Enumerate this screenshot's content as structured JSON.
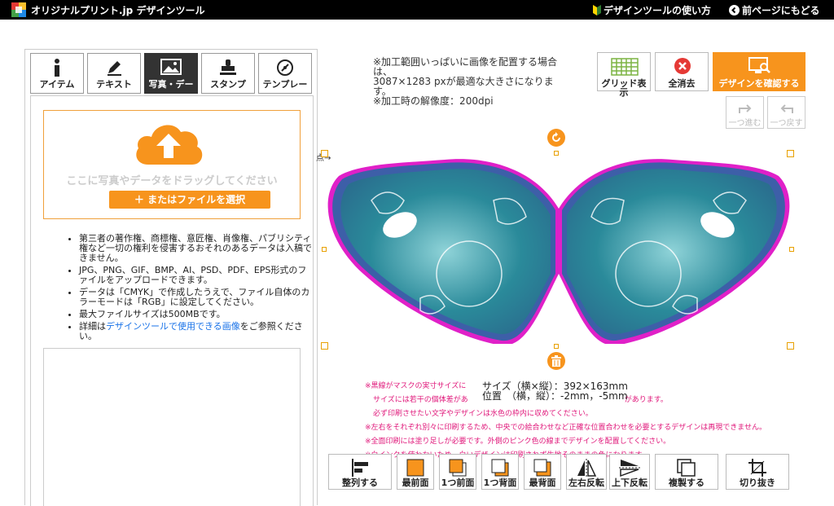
{
  "topbar": {
    "brand": "オリジナルプリント.jp デザインツール",
    "help_link": "デザインツールの使い方",
    "back_link": "前ページにもどる"
  },
  "tabs": [
    {
      "label": "アイテム",
      "icon": "info-icon"
    },
    {
      "label": "テキスト",
      "icon": "pen-icon"
    },
    {
      "label": "写真・デー",
      "icon": "image-icon",
      "active": true
    },
    {
      "label": "スタンプ",
      "icon": "stamp-icon"
    },
    {
      "label": "テンプレー",
      "icon": "template-icon"
    }
  ],
  "upload": {
    "drop_text": "ここに写真やデータをドラッグしてください",
    "file_button": "＋ またはファイルを選択"
  },
  "notes": {
    "n1": "第三者の著作権、商標権、意匠権、肖像権、パブリシティ権など一切の権利を侵害するおそれのあるデータは入稿できません。",
    "n2": "JPG、PNG、GIF、BMP、AI、PSD、PDF、EPS形式のファイルをアップロードできます。",
    "n3": "データは「CMYK」で作成したうえで、ファイル自体のカラーモードは「RGB」に設定してください。",
    "n4": "最大ファイルサイズは500MBです。",
    "n5_pre": "詳細は",
    "n5_link": "デザインツールで使用できる画像",
    "n5_post": "をご参照ください。"
  },
  "hint": {
    "line1": "※加工範囲いっぱいに画像を配置する場合は、",
    "line2": "3087×1283 pxが最適な大きさになります。",
    "line3": "※加工時の解像度：200dpi"
  },
  "toolbar": {
    "grid_label": "グリッド表示",
    "clear_label": "全消去",
    "confirm_label": "デザインを確認する",
    "redo_label": "一つ進む",
    "undo_label": "一つ戻す"
  },
  "canvas": {
    "arrow_mark": "点→"
  },
  "size_info": {
    "size": "サイズ（横×縦）：392×163mm",
    "position": "位置　（横，縦）：-2mm，-5mm"
  },
  "warnings": {
    "w1": "※黒線がマスクの実寸サイズに",
    "w2": "サイズには若干の個体差があ",
    "w2b": "があります。",
    "w3": "必ず印刷させたい文字やデザインは水色の枠内に収めてください。",
    "w4": "※左右をそれぞれ別々に印刷するため、中央での絵合わせなど正確な位置合わせを必要とするデザインは再現できません。",
    "w5": "※全面印刷には塗り足しが必要です。外側のピンク色の線までデザインを配置してください。",
    "w6": "※白インクを使わないため、白いデザインは印刷されず生地そのままの色になります。"
  },
  "bottom_buttons": [
    {
      "label": "整列する"
    },
    {
      "label": "最前面"
    },
    {
      "label": "1つ前面"
    },
    {
      "label": "1つ背面"
    },
    {
      "label": "最背面"
    },
    {
      "label": "左右反転"
    },
    {
      "label": "上下反転"
    },
    {
      "label": "複製する"
    },
    {
      "label": "切り抜き"
    }
  ],
  "colors": {
    "accent": "#f7941d",
    "mask_teal": "#2a8a9a",
    "mask_blue": "#3d5fa8",
    "outline_pink": "#e020c8",
    "warning": "#e0177a"
  }
}
